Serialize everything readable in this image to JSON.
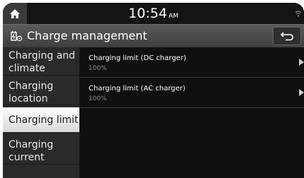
{
  "status_bar": {
    "time": "10:54",
    "ampm": "AM",
    "home_icon": "home-icon",
    "signal_icon": "signal-icon"
  },
  "header": {
    "title": "Charge management",
    "title_icon": "ev-charge-icon",
    "back_icon": "back-arrow-icon"
  },
  "sidebar": {
    "items": [
      {
        "label_line1": "Charging and",
        "label_line2": "climate",
        "selected": false
      },
      {
        "label_line1": "Charging",
        "label_line2": "location",
        "selected": false
      },
      {
        "label_line1": "Charging limit",
        "label_line2": "",
        "selected": true
      },
      {
        "label_line1": "Charging",
        "label_line2": "current",
        "selected": false
      }
    ]
  },
  "main": {
    "rows": [
      {
        "title": "Charging limit (DC charger)",
        "value": "100%"
      },
      {
        "title": "Charging limit (AC charger)",
        "value": "100%"
      }
    ]
  },
  "colors": {
    "background": "#1a1a1a",
    "selected_item": "#ffffff",
    "text": "#ffffff",
    "subtext": "#8a8a8a"
  }
}
